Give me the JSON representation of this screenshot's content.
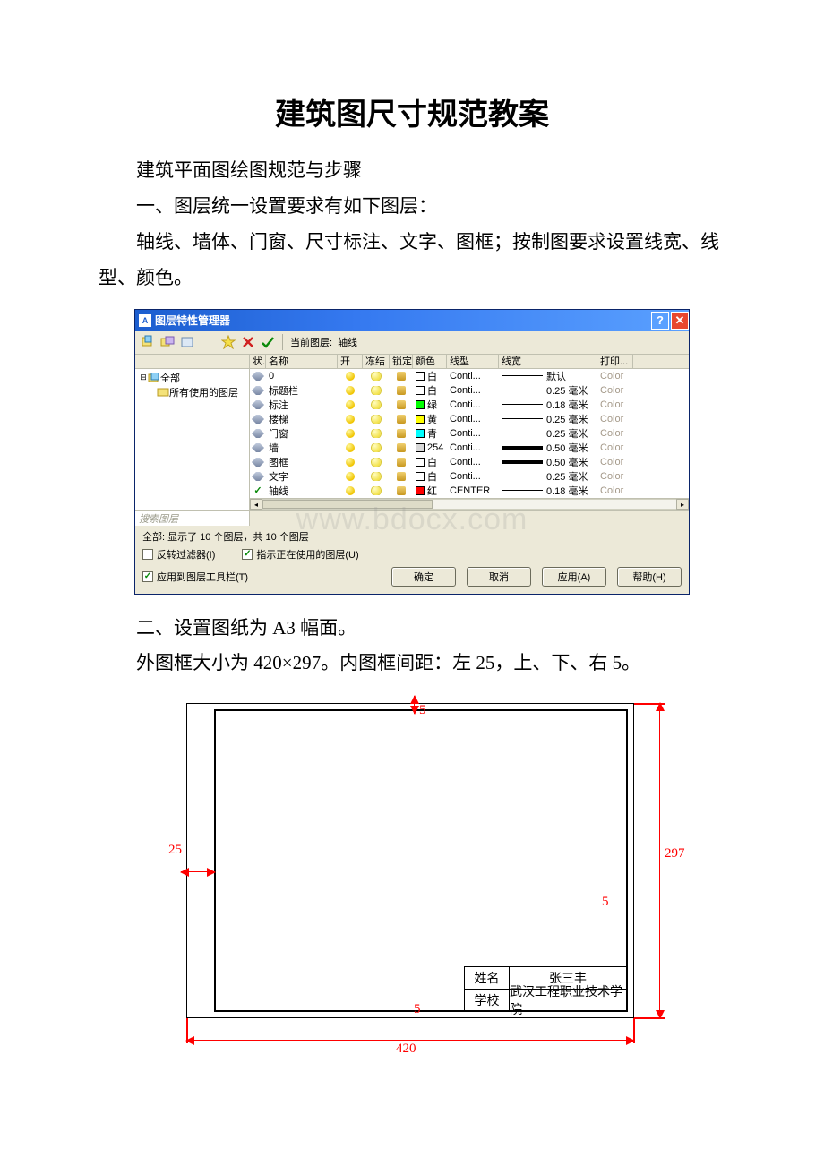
{
  "title": "建筑图尺寸规范教案",
  "p1": "建筑平面图绘图规范与步骤",
  "p2": "一、图层统一设置要求有如下图层：",
  "p3": "轴线、墙体、门窗、尺寸标注、文字、图框；按制图要求设置线宽、线型、颜色。",
  "p4": "二、设置图纸为 A3 幅面。",
  "p5": "外图框大小为 420×297。内图框间距：左 25，上、下、右 5。",
  "lpm": {
    "title": "图层特性管理器",
    "help_glyph": "?",
    "close_glyph": "✕",
    "current_layer_label": "当前图层:",
    "current_layer_value": "轴线",
    "tree": {
      "root": "全部",
      "child": "所有使用的图层"
    },
    "cols": {
      "stat": "状..",
      "name": "名称",
      "on": "开",
      "frz": "冻结",
      "lock": "锁定",
      "color": "颜色",
      "ltype": "线型",
      "lwt": "线宽",
      "print": "打印..."
    },
    "rows": [
      {
        "name": "0",
        "color": "#ffffff",
        "colorlabel": "白",
        "ltype": "Conti...",
        "lwt": "默认",
        "thick": false
      },
      {
        "name": "标题栏",
        "color": "#ffffff",
        "colorlabel": "白",
        "ltype": "Conti...",
        "lwt": "0.25 毫米",
        "thick": false
      },
      {
        "name": "标注",
        "color": "#00ff00",
        "colorlabel": "绿",
        "ltype": "Conti...",
        "lwt": "0.18 毫米",
        "thick": false
      },
      {
        "name": "楼梯",
        "color": "#ffff00",
        "colorlabel": "黄",
        "ltype": "Conti...",
        "lwt": "0.25 毫米",
        "thick": false
      },
      {
        "name": "门窗",
        "color": "#00ffff",
        "colorlabel": "青",
        "ltype": "Conti...",
        "lwt": "0.25 毫米",
        "thick": false
      },
      {
        "name": "墙",
        "color": "#d8d8d8",
        "colorlabel": "254",
        "ltype": "Conti...",
        "lwt": "0.50 毫米",
        "thick": true
      },
      {
        "name": "图框",
        "color": "#ffffff",
        "colorlabel": "白",
        "ltype": "Conti...",
        "lwt": "0.50 毫米",
        "thick": true
      },
      {
        "name": "文字",
        "color": "#ffffff",
        "colorlabel": "白",
        "ltype": "Conti...",
        "lwt": "0.25 毫米",
        "thick": false
      },
      {
        "name": "轴线",
        "color": "#ff0000",
        "colorlabel": "红",
        "ltype": "CENTER",
        "lwt": "0.18 毫米",
        "thick": false,
        "current": true
      }
    ],
    "print_cell": "Color",
    "search_placeholder": "搜索图层",
    "status": "全部: 显示了 10 个图层，共 10 个图层",
    "chk_invert": "反转过滤器(I)",
    "chk_indicate": "指示正在使用的图层(U)",
    "chk_apply_toolbar": "应用到图层工具栏(T)",
    "btn_ok": "确定",
    "btn_cancel": "取消",
    "btn_apply": "应用(A)",
    "btn_help": "帮助(H)",
    "watermark": "www.bdocx.com"
  },
  "frame": {
    "dim_top": "5",
    "dim_left": "25",
    "dim_bottom_gap": "5",
    "dim_right_gap": "5",
    "dim_width": "420",
    "dim_height": "297",
    "tb_name_l": "姓名",
    "tb_name_v": "张三丰",
    "tb_school_l": "学校",
    "tb_school_v": "武汉工程职业技术学院"
  }
}
